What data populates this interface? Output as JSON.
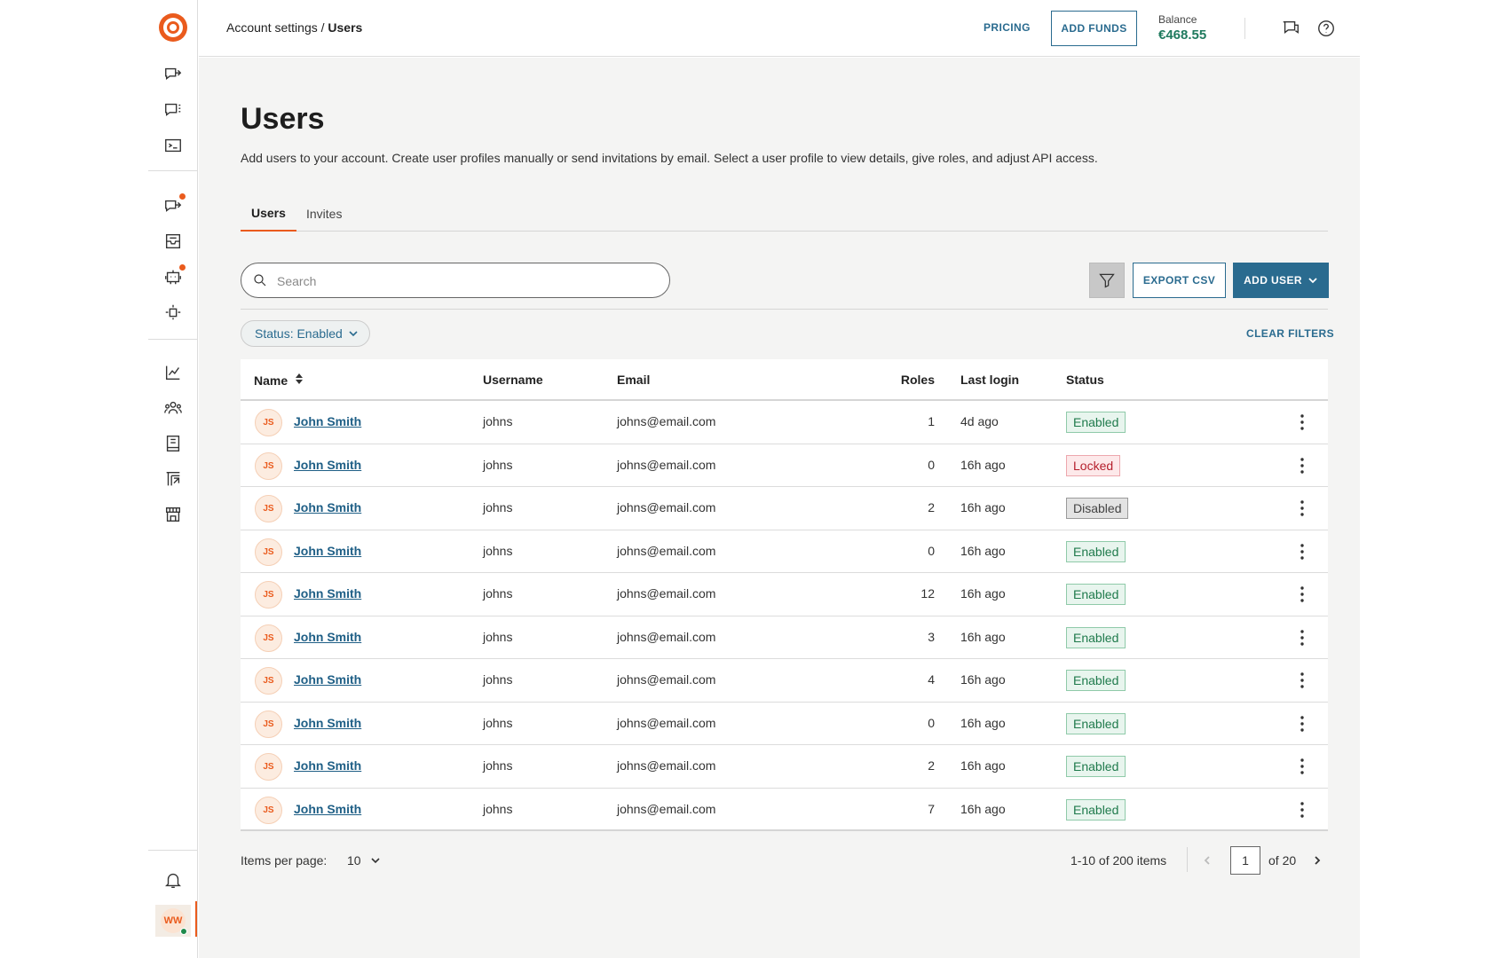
{
  "header": {
    "breadcrumb_parent": "Account settings",
    "breadcrumb_sep": " / ",
    "breadcrumb_current": "Users",
    "pricing_label": "PRICING",
    "add_funds_label": "ADD FUNDS",
    "balance_label": "Balance",
    "balance_value": "€468.55"
  },
  "page": {
    "title": "Users",
    "description": "Add users to your account. Create user profiles manually or send invitations by email. Select a user profile to view details, give roles, and adjust API access."
  },
  "tabs": [
    {
      "label": "Users",
      "active": true
    },
    {
      "label": "Invites",
      "active": false
    }
  ],
  "toolbar": {
    "search_placeholder": "Search",
    "export_label": "EXPORT CSV",
    "add_user_label": "ADD USER"
  },
  "filters": {
    "chip_label": "Status: Enabled",
    "clear_label": "CLEAR FILTERS"
  },
  "table": {
    "columns": {
      "name": "Name",
      "username": "Username",
      "email": "Email",
      "roles": "Roles",
      "last_login": "Last login",
      "status": "Status"
    },
    "rows": [
      {
        "initials": "JS",
        "name": "John Smith",
        "username": "johns",
        "email": "johns@email.com",
        "roles": "1",
        "last_login": "4d ago",
        "status": "Enabled"
      },
      {
        "initials": "JS",
        "name": "John Smith",
        "username": "johns",
        "email": "johns@email.com",
        "roles": "0",
        "last_login": "16h ago",
        "status": "Locked"
      },
      {
        "initials": "JS",
        "name": "John Smith",
        "username": "johns",
        "email": "johns@email.com",
        "roles": "2",
        "last_login": "16h ago",
        "status": "Disabled"
      },
      {
        "initials": "JS",
        "name": "John Smith",
        "username": "johns",
        "email": "johns@email.com",
        "roles": "0",
        "last_login": "16h ago",
        "status": "Enabled"
      },
      {
        "initials": "JS",
        "name": "John Smith",
        "username": "johns",
        "email": "johns@email.com",
        "roles": "12",
        "last_login": "16h ago",
        "status": "Enabled"
      },
      {
        "initials": "JS",
        "name": "John Smith",
        "username": "johns",
        "email": "johns@email.com",
        "roles": "3",
        "last_login": "16h ago",
        "status": "Enabled"
      },
      {
        "initials": "JS",
        "name": "John Smith",
        "username": "johns",
        "email": "johns@email.com",
        "roles": "4",
        "last_login": "16h ago",
        "status": "Enabled"
      },
      {
        "initials": "JS",
        "name": "John Smith",
        "username": "johns",
        "email": "johns@email.com",
        "roles": "0",
        "last_login": "16h ago",
        "status": "Enabled"
      },
      {
        "initials": "JS",
        "name": "John Smith",
        "username": "johns",
        "email": "johns@email.com",
        "roles": "2",
        "last_login": "16h ago",
        "status": "Enabled"
      },
      {
        "initials": "JS",
        "name": "John Smith",
        "username": "johns",
        "email": "johns@email.com",
        "roles": "7",
        "last_login": "16h ago",
        "status": "Enabled"
      }
    ]
  },
  "pagination": {
    "items_per_page_label": "Items per page:",
    "items_per_page_value": "10",
    "range_text": "1-10 of 200 items",
    "current_page": "1",
    "of_pages": "of 20"
  },
  "sidebar": {
    "user_initials": "WW"
  },
  "colors": {
    "brand": "#ea5b1d",
    "primary": "#2a6b8f",
    "enabled": "#1f7a4c",
    "locked": "#b51f2c",
    "disabled": "#444444"
  }
}
